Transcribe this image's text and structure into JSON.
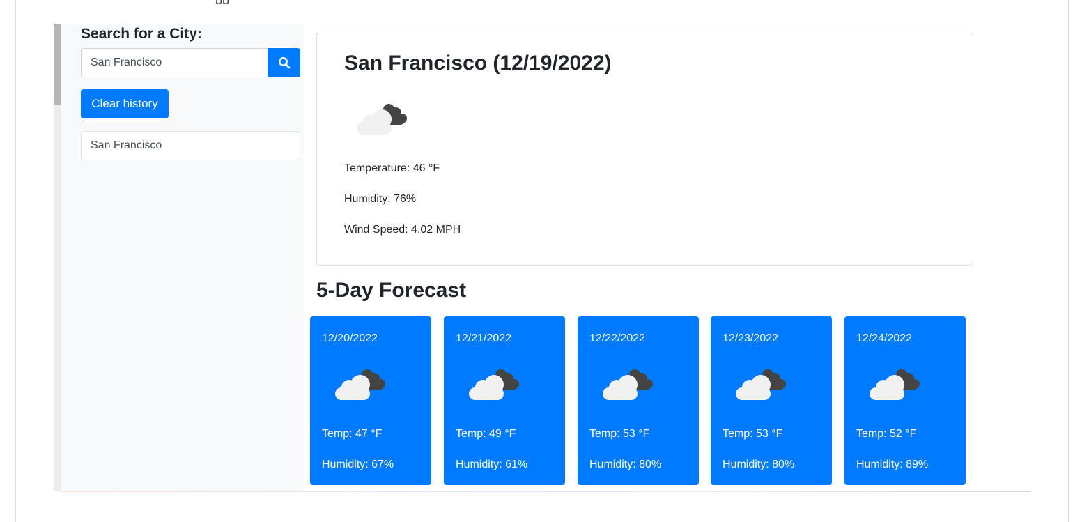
{
  "sidebar": {
    "title": "Search for a City:",
    "search_value": "San Francisco",
    "search_icon": "search-icon",
    "clear_label": "Clear history",
    "history": [
      "San Francisco"
    ]
  },
  "current": {
    "title": "San Francisco (12/19/2022)",
    "icon": "broken-clouds-icon",
    "temperature": "Temperature: 46 °F",
    "humidity": "Humidity: 76%",
    "wind": "Wind Speed: 4.02 MPH"
  },
  "forecast": {
    "title": "5-Day Forecast",
    "days": [
      {
        "date": "12/20/2022",
        "icon": "broken-clouds-icon",
        "temp": "Temp: 47 °F",
        "humidity": "Humidity: 67%"
      },
      {
        "date": "12/21/2022",
        "icon": "broken-clouds-icon",
        "temp": "Temp: 49 °F",
        "humidity": "Humidity: 61%"
      },
      {
        "date": "12/22/2022",
        "icon": "broken-clouds-icon",
        "temp": "Temp: 53 °F",
        "humidity": "Humidity: 80%"
      },
      {
        "date": "12/23/2022",
        "icon": "broken-clouds-icon",
        "temp": "Temp: 53 °F",
        "humidity": "Humidity: 80%"
      },
      {
        "date": "12/24/2022",
        "icon": "broken-clouds-icon",
        "temp": "Temp: 52 °F",
        "humidity": "Humidity: 89%"
      }
    ]
  },
  "colors": {
    "primary": "#007bff",
    "sidebar_bg": "#f8f9fa",
    "cloud_light": "#f1f1f1",
    "cloud_dark": "#444444"
  }
}
